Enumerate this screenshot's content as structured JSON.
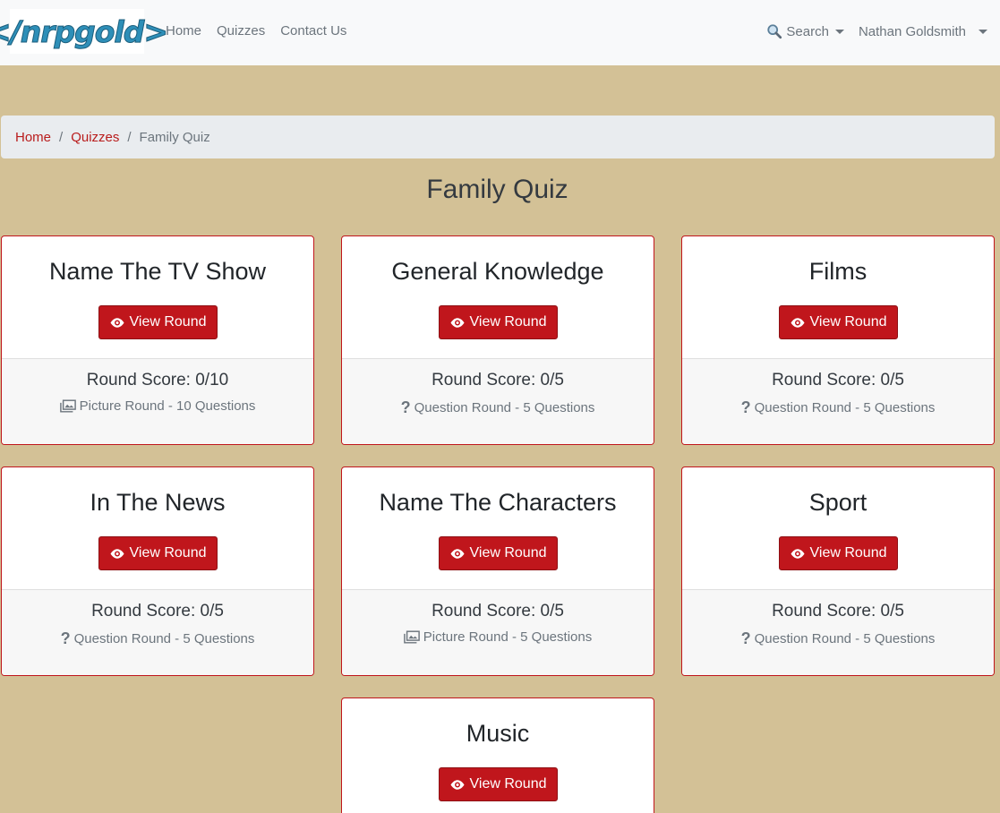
{
  "nav": {
    "logo_text": "</nrpgold>",
    "links": [
      "Home",
      "Quizzes",
      "Contact Us"
    ],
    "search_label": "Search",
    "user_name": "Nathan Goldsmith"
  },
  "breadcrumb": {
    "home": "Home",
    "quizzes": "Quizzes",
    "current": "Family Quiz",
    "separator": "/"
  },
  "page_title": "Family Quiz",
  "view_label": "View Round",
  "rounds": [
    {
      "title": "Name The TV Show",
      "score": "Round Score: 0/10",
      "type_icon": "picture-icon",
      "meta": "Picture Round - 10 Questions"
    },
    {
      "title": "General Knowledge",
      "score": "Round Score: 0/5",
      "type_icon": "question-icon",
      "meta": "Question Round - 5 Questions"
    },
    {
      "title": "Films",
      "score": "Round Score: 0/5",
      "type_icon": "question-icon",
      "meta": "Question Round - 5 Questions"
    },
    {
      "title": "In The News",
      "score": "Round Score: 0/5",
      "type_icon": "question-icon",
      "meta": "Question Round - 5 Questions"
    },
    {
      "title": "Name The Characters",
      "score": "Round Score: 0/5",
      "type_icon": "picture-icon",
      "meta": "Picture Round - 5 Questions"
    },
    {
      "title": "Sport",
      "score": "Round Score: 0/5",
      "type_icon": "question-icon",
      "meta": "Question Round - 5 Questions"
    },
    {
      "title": "Music"
    }
  ],
  "colors": {
    "background": "#d3c196",
    "accent": "#c0161c",
    "navbar": "#f8f9fa"
  }
}
